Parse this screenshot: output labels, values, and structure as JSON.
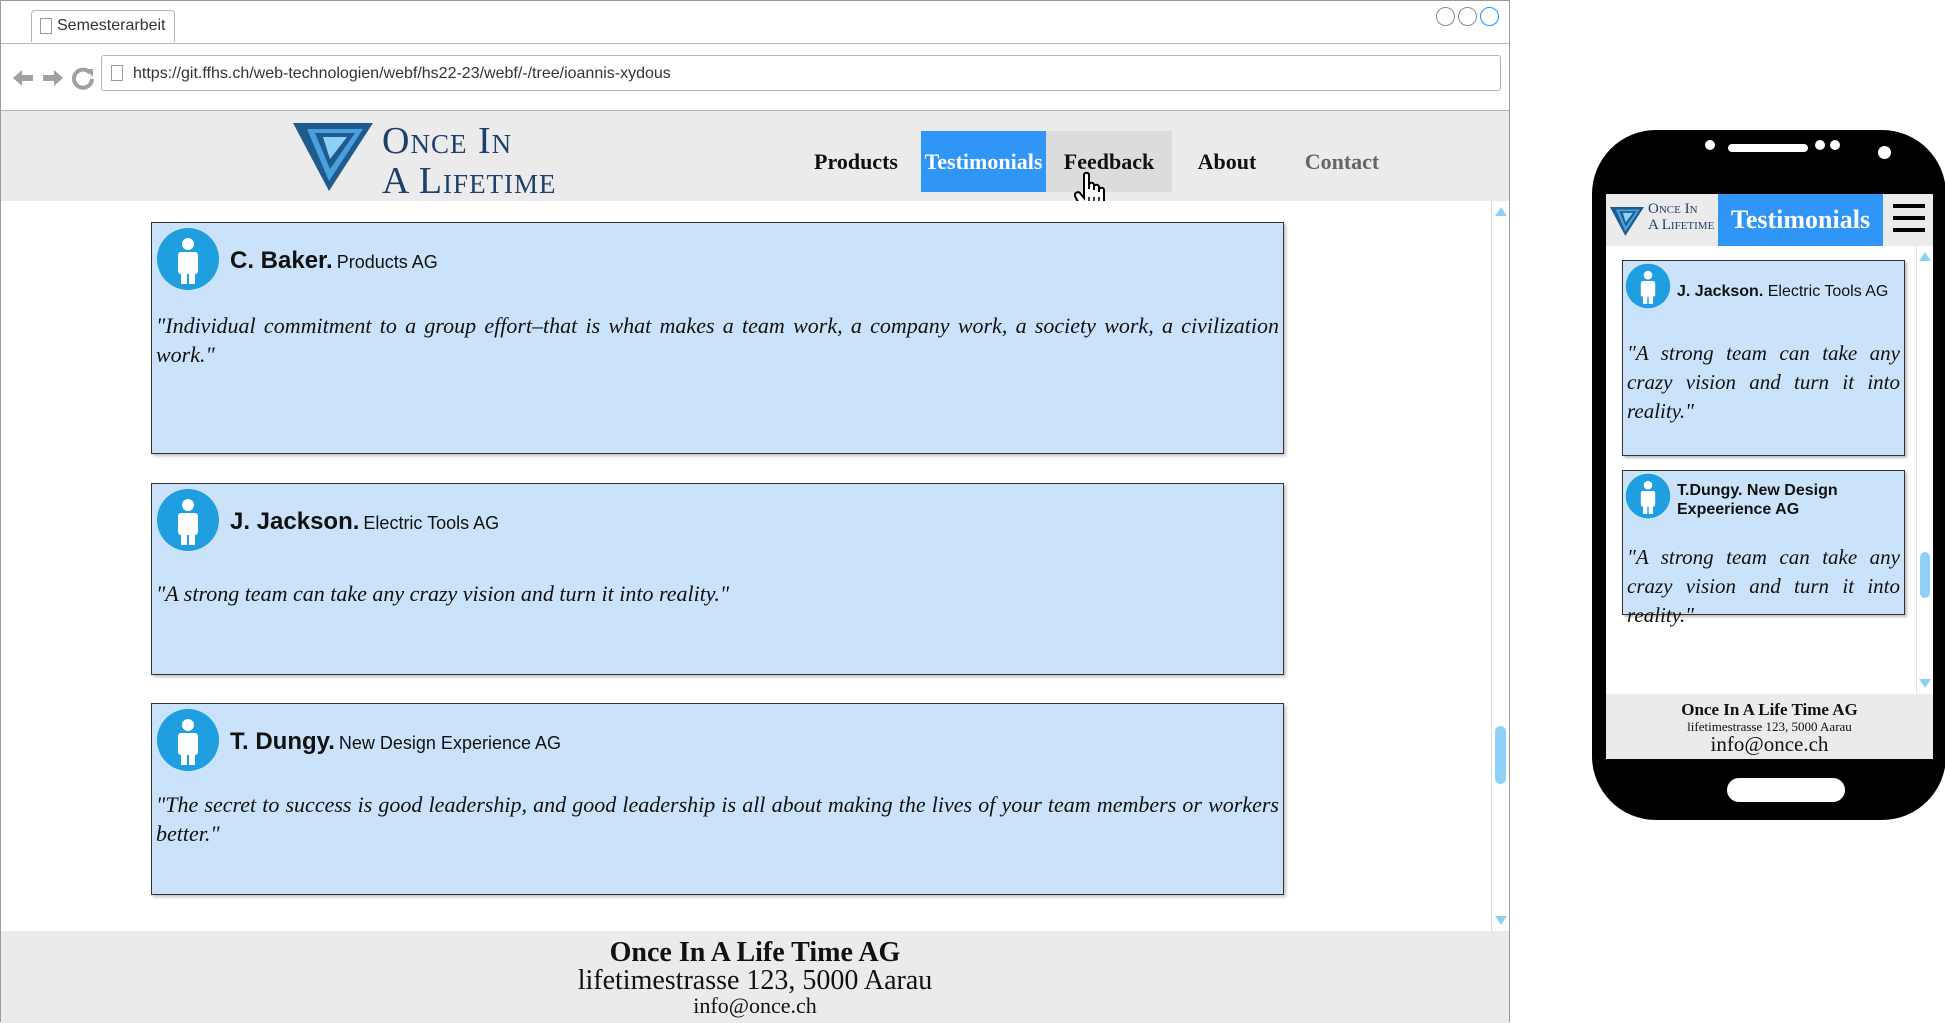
{
  "browser": {
    "tab_title": "Semesterarbeit",
    "url": "https://git.ffhs.ch/web-technologien/webf/hs22-23/webf/-/tree/ioannis-xydous"
  },
  "site": {
    "logo": {
      "line1": "Once In",
      "line2": "A Lifetime"
    },
    "nav": [
      {
        "label": "Products",
        "state": "normal"
      },
      {
        "label": "Testimonials",
        "state": "active"
      },
      {
        "label": "Feedback",
        "state": "hover"
      },
      {
        "label": "About",
        "state": "normal"
      },
      {
        "label": "Contact",
        "state": "muted"
      }
    ],
    "testimonials": [
      {
        "name": "C. Baker.",
        "company": "Products AG",
        "quote": "\"Individual commitment to a group effort–that is what makes a team work, a company work, a society work, a civilization work.\""
      },
      {
        "name": "J. Jackson.",
        "company": "Electric Tools AG",
        "quote": "\"A strong team can take any crazy vision and turn it into reality.\""
      },
      {
        "name": "T. Dungy.",
        "company": "New Design Experience AG",
        "quote": "\"The secret to success is good leadership, and good leadership is all about making the lives of your team members or workers better.\""
      }
    ],
    "footer": {
      "company": "Once In A Life Time AG",
      "address": "lifetimestrasse 123, 5000 Aarau",
      "email": "info@once.ch"
    }
  },
  "mobile": {
    "logo": {
      "line1": "Once In",
      "line2": "A Lifetime"
    },
    "title": "Testimonials",
    "cards": [
      {
        "name": "J. Jackson.",
        "company": "Electric Tools AG",
        "quote": "\"A strong team can take any crazy vision and turn it into reality.\""
      },
      {
        "name": "T.Dungy. New Design",
        "company": "Expeerience AG",
        "quote": "\"A strong team can take any crazy vision and turn it into reality.\""
      }
    ],
    "footer": {
      "company": "Once In A Life Time AG",
      "address": "lifetimestrasse 123, 5000 Aarau",
      "email": "info@once.ch"
    }
  },
  "colors": {
    "accent": "#2f95f6",
    "card_bg": "#cae3fa",
    "logo_blue": "#1e3f6b",
    "header_bg": "#ebebeb",
    "scroll_thumb": "#8fd0f7"
  }
}
